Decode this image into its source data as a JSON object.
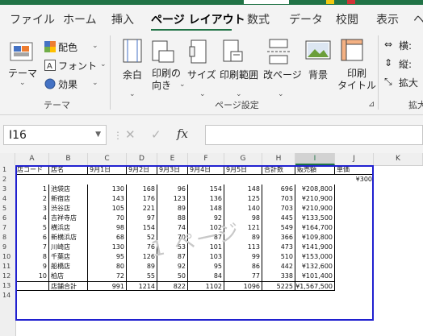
{
  "ribbon_tabs": [
    "ファイル",
    "ホーム",
    "挿入",
    "ページ レイアウト",
    "数式",
    "データ",
    "校閲",
    "表示",
    "ヘ"
  ],
  "ribbon": {
    "theme": {
      "themes_label": "テーマ",
      "colors_label": "配色",
      "fonts_label": "フォント",
      "effects_label": "効果",
      "group_label": "テーマ"
    },
    "page_setup": {
      "margins_label": "余白",
      "orientation_label": "印刷の\n向き",
      "size_label": "サイズ",
      "print_area_label": "印刷範囲",
      "breaks_label": "改ページ",
      "background_label": "背景",
      "print_titles_label": "印刷\nタイトル",
      "group_label": "ページ設定"
    },
    "scale": {
      "width_label": "横:",
      "height_label": "縦:",
      "scale_label": "拡大",
      "group_label": "拡大"
    }
  },
  "formula_bar": {
    "name_box": "I16",
    "fx_label": "fx",
    "content": ""
  },
  "column_headers": [
    "A",
    "B",
    "C",
    "D",
    "E",
    "F",
    "G",
    "H",
    "I",
    "J",
    "K"
  ],
  "selected_column": "I",
  "row_headers": [
    "1",
    "2",
    "3",
    "4",
    "5",
    "6",
    "7",
    "8",
    "9",
    "10",
    "11",
    "12",
    "13",
    "14"
  ],
  "sheet": {
    "header_row": [
      "店コード",
      "店名",
      "9月1日",
      "9月2日",
      "9月3日",
      "9月4日",
      "9月5日",
      "合計数",
      "販売額",
      "単価"
    ],
    "unit_price": "¥300",
    "rows": [
      [
        "1",
        "池袋店",
        "130",
        "168",
        "96",
        "154",
        "148",
        "696",
        "¥208,800"
      ],
      [
        "2",
        "新宿店",
        "143",
        "176",
        "123",
        "136",
        "125",
        "703",
        "¥210,900"
      ],
      [
        "3",
        "渋谷店",
        "105",
        "221",
        "89",
        "148",
        "140",
        "703",
        "¥210,900"
      ],
      [
        "4",
        "吉祥寺店",
        "70",
        "97",
        "88",
        "92",
        "98",
        "445",
        "¥133,500"
      ],
      [
        "5",
        "横浜店",
        "98",
        "154",
        "74",
        "102",
        "121",
        "549",
        "¥164,700"
      ],
      [
        "6",
        "新横浜店",
        "68",
        "52",
        "70",
        "87",
        "89",
        "366",
        "¥109,800"
      ],
      [
        "7",
        "川崎店",
        "130",
        "76",
        "53",
        "101",
        "113",
        "473",
        "¥141,900"
      ],
      [
        "8",
        "千葉店",
        "95",
        "126",
        "87",
        "103",
        "99",
        "510",
        "¥153,000"
      ],
      [
        "9",
        "船橋店",
        "80",
        "89",
        "92",
        "95",
        "86",
        "442",
        "¥132,600"
      ],
      [
        "10",
        "柏店",
        "72",
        "55",
        "50",
        "84",
        "77",
        "338",
        "¥101,400"
      ]
    ],
    "total_row": [
      "",
      "店舗合計",
      "991",
      "1214",
      "822",
      "1102",
      "1096",
      "5225",
      "¥1,567,500"
    ]
  },
  "page_watermark": "1 ページ",
  "colors": {
    "accent": "#217346",
    "print_area_border": "#2020d0",
    "watermark": "#c8c8c8"
  }
}
